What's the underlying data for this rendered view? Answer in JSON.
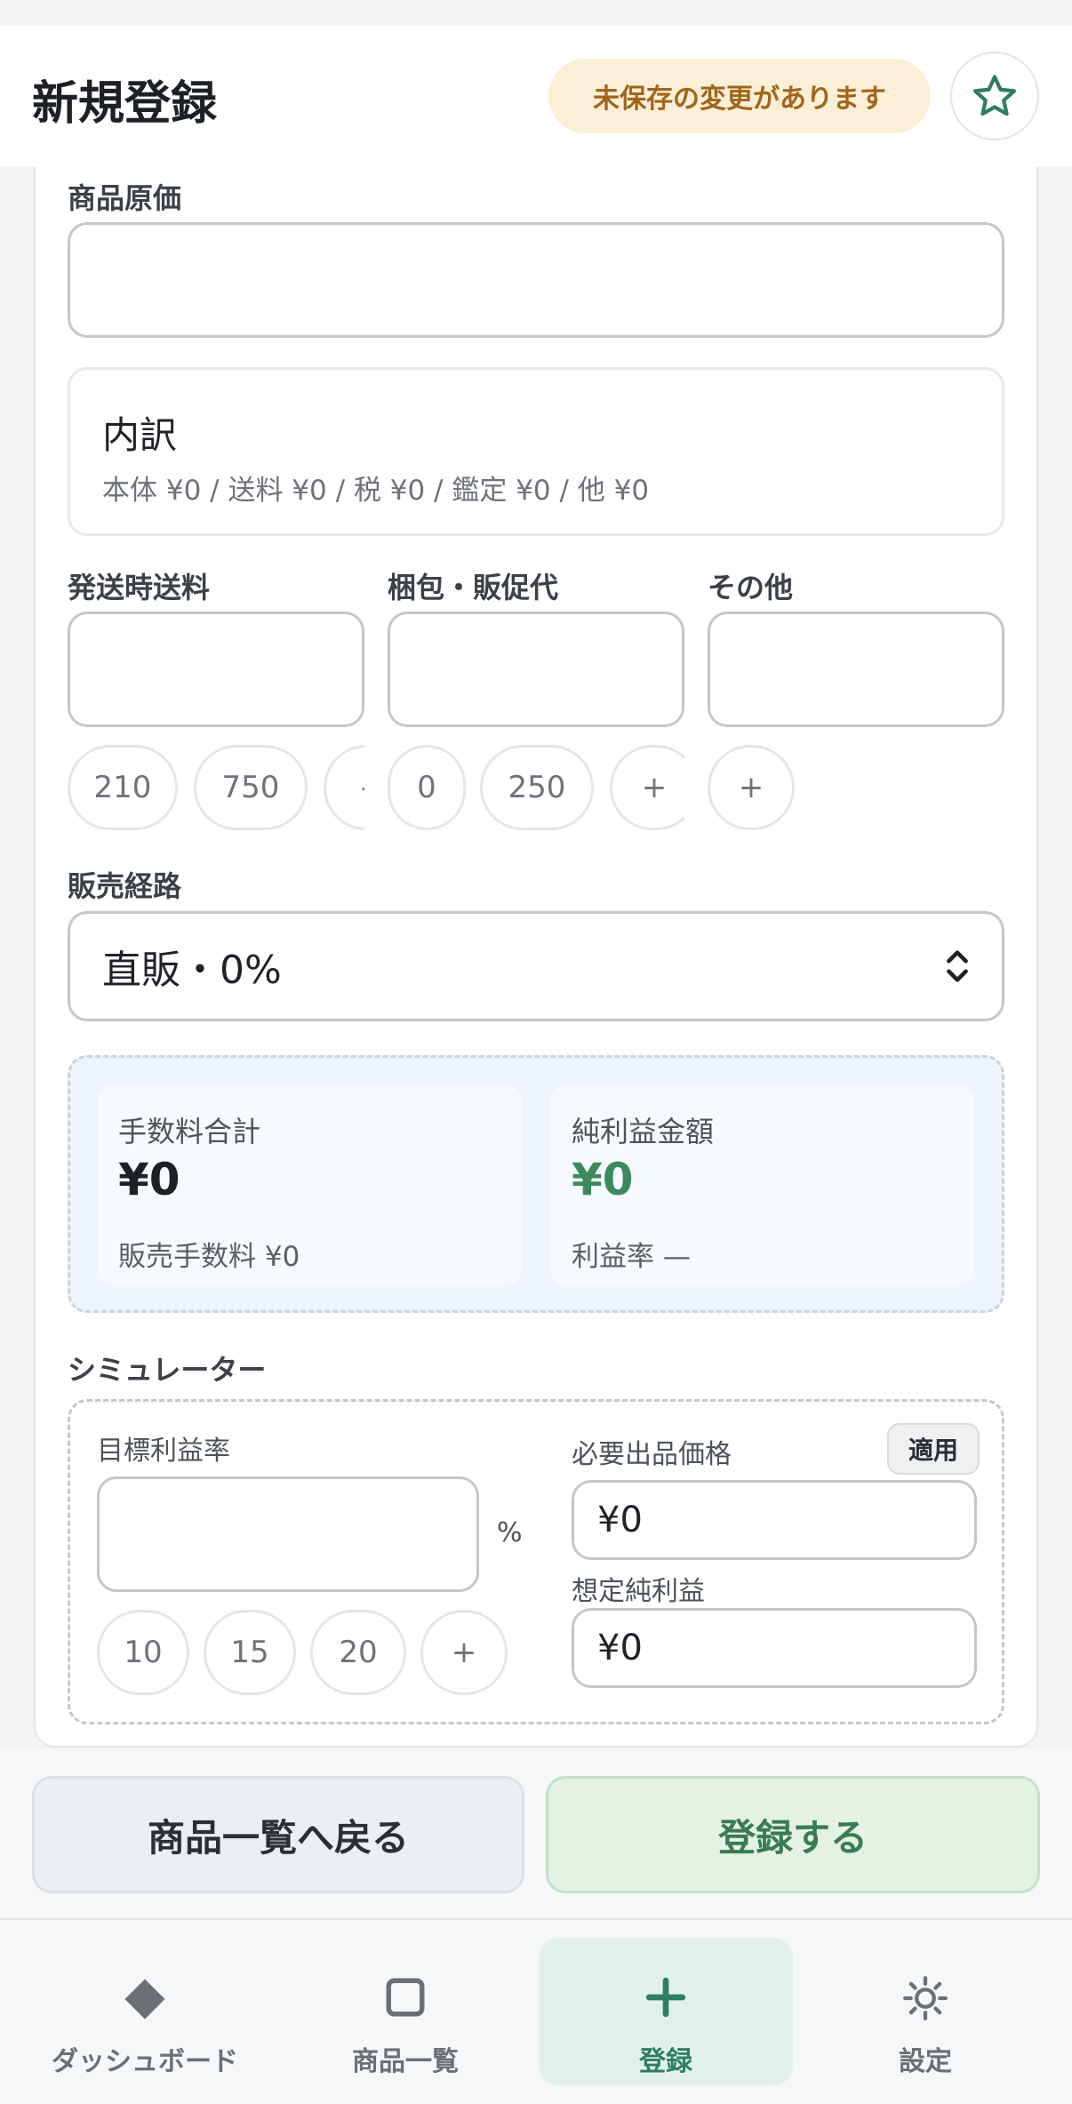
{
  "header": {
    "title": "新規登録",
    "unsaved_badge": "未保存の変更があります",
    "favorite_icon": "star-icon"
  },
  "form": {
    "cost_price": {
      "label": "商品原価",
      "value": ""
    },
    "breakdown": {
      "title": "内訳",
      "detail": "本体 ¥0 / 送料 ¥0 / 税 ¥0 / 鑑定 ¥0 / 他 ¥0"
    },
    "shipping": {
      "label": "発送時送料",
      "value": "",
      "chips": [
        "210",
        "750",
        "-"
      ]
    },
    "packing": {
      "label": "梱包・販促代",
      "value": "",
      "chips": [
        "0",
        "250",
        "+"
      ]
    },
    "other": {
      "label": "その他",
      "value": "",
      "chips": [
        "+"
      ]
    },
    "channel": {
      "label": "販売経路",
      "selected": "直販・0%"
    }
  },
  "summary": {
    "fees": {
      "label": "手数料合計",
      "value": "¥0",
      "sub": "販売手数料 ¥0"
    },
    "profit": {
      "label": "純利益金額",
      "value": "¥0",
      "sub": "利益率 —",
      "color": "#3a8a5c"
    }
  },
  "simulator": {
    "title": "シミュレーター",
    "target_rate": {
      "label": "目標利益率",
      "value": "",
      "unit": "%",
      "chips": [
        "10",
        "15",
        "20",
        "+"
      ]
    },
    "required_price": {
      "label": "必要出品価格",
      "value": "¥0",
      "apply_label": "適用"
    },
    "expected_profit": {
      "label": "想定純利益",
      "value": "¥0"
    }
  },
  "footer": {
    "back_label": "商品一覧へ戻る",
    "register_label": "登録する"
  },
  "tabbar": {
    "items": [
      {
        "label": "ダッシュボード",
        "icon": "diamond-icon"
      },
      {
        "label": "商品一覧",
        "icon": "square-icon"
      },
      {
        "label": "登録",
        "icon": "plus-icon",
        "active": true
      },
      {
        "label": "設定",
        "icon": "sun-icon"
      }
    ]
  }
}
